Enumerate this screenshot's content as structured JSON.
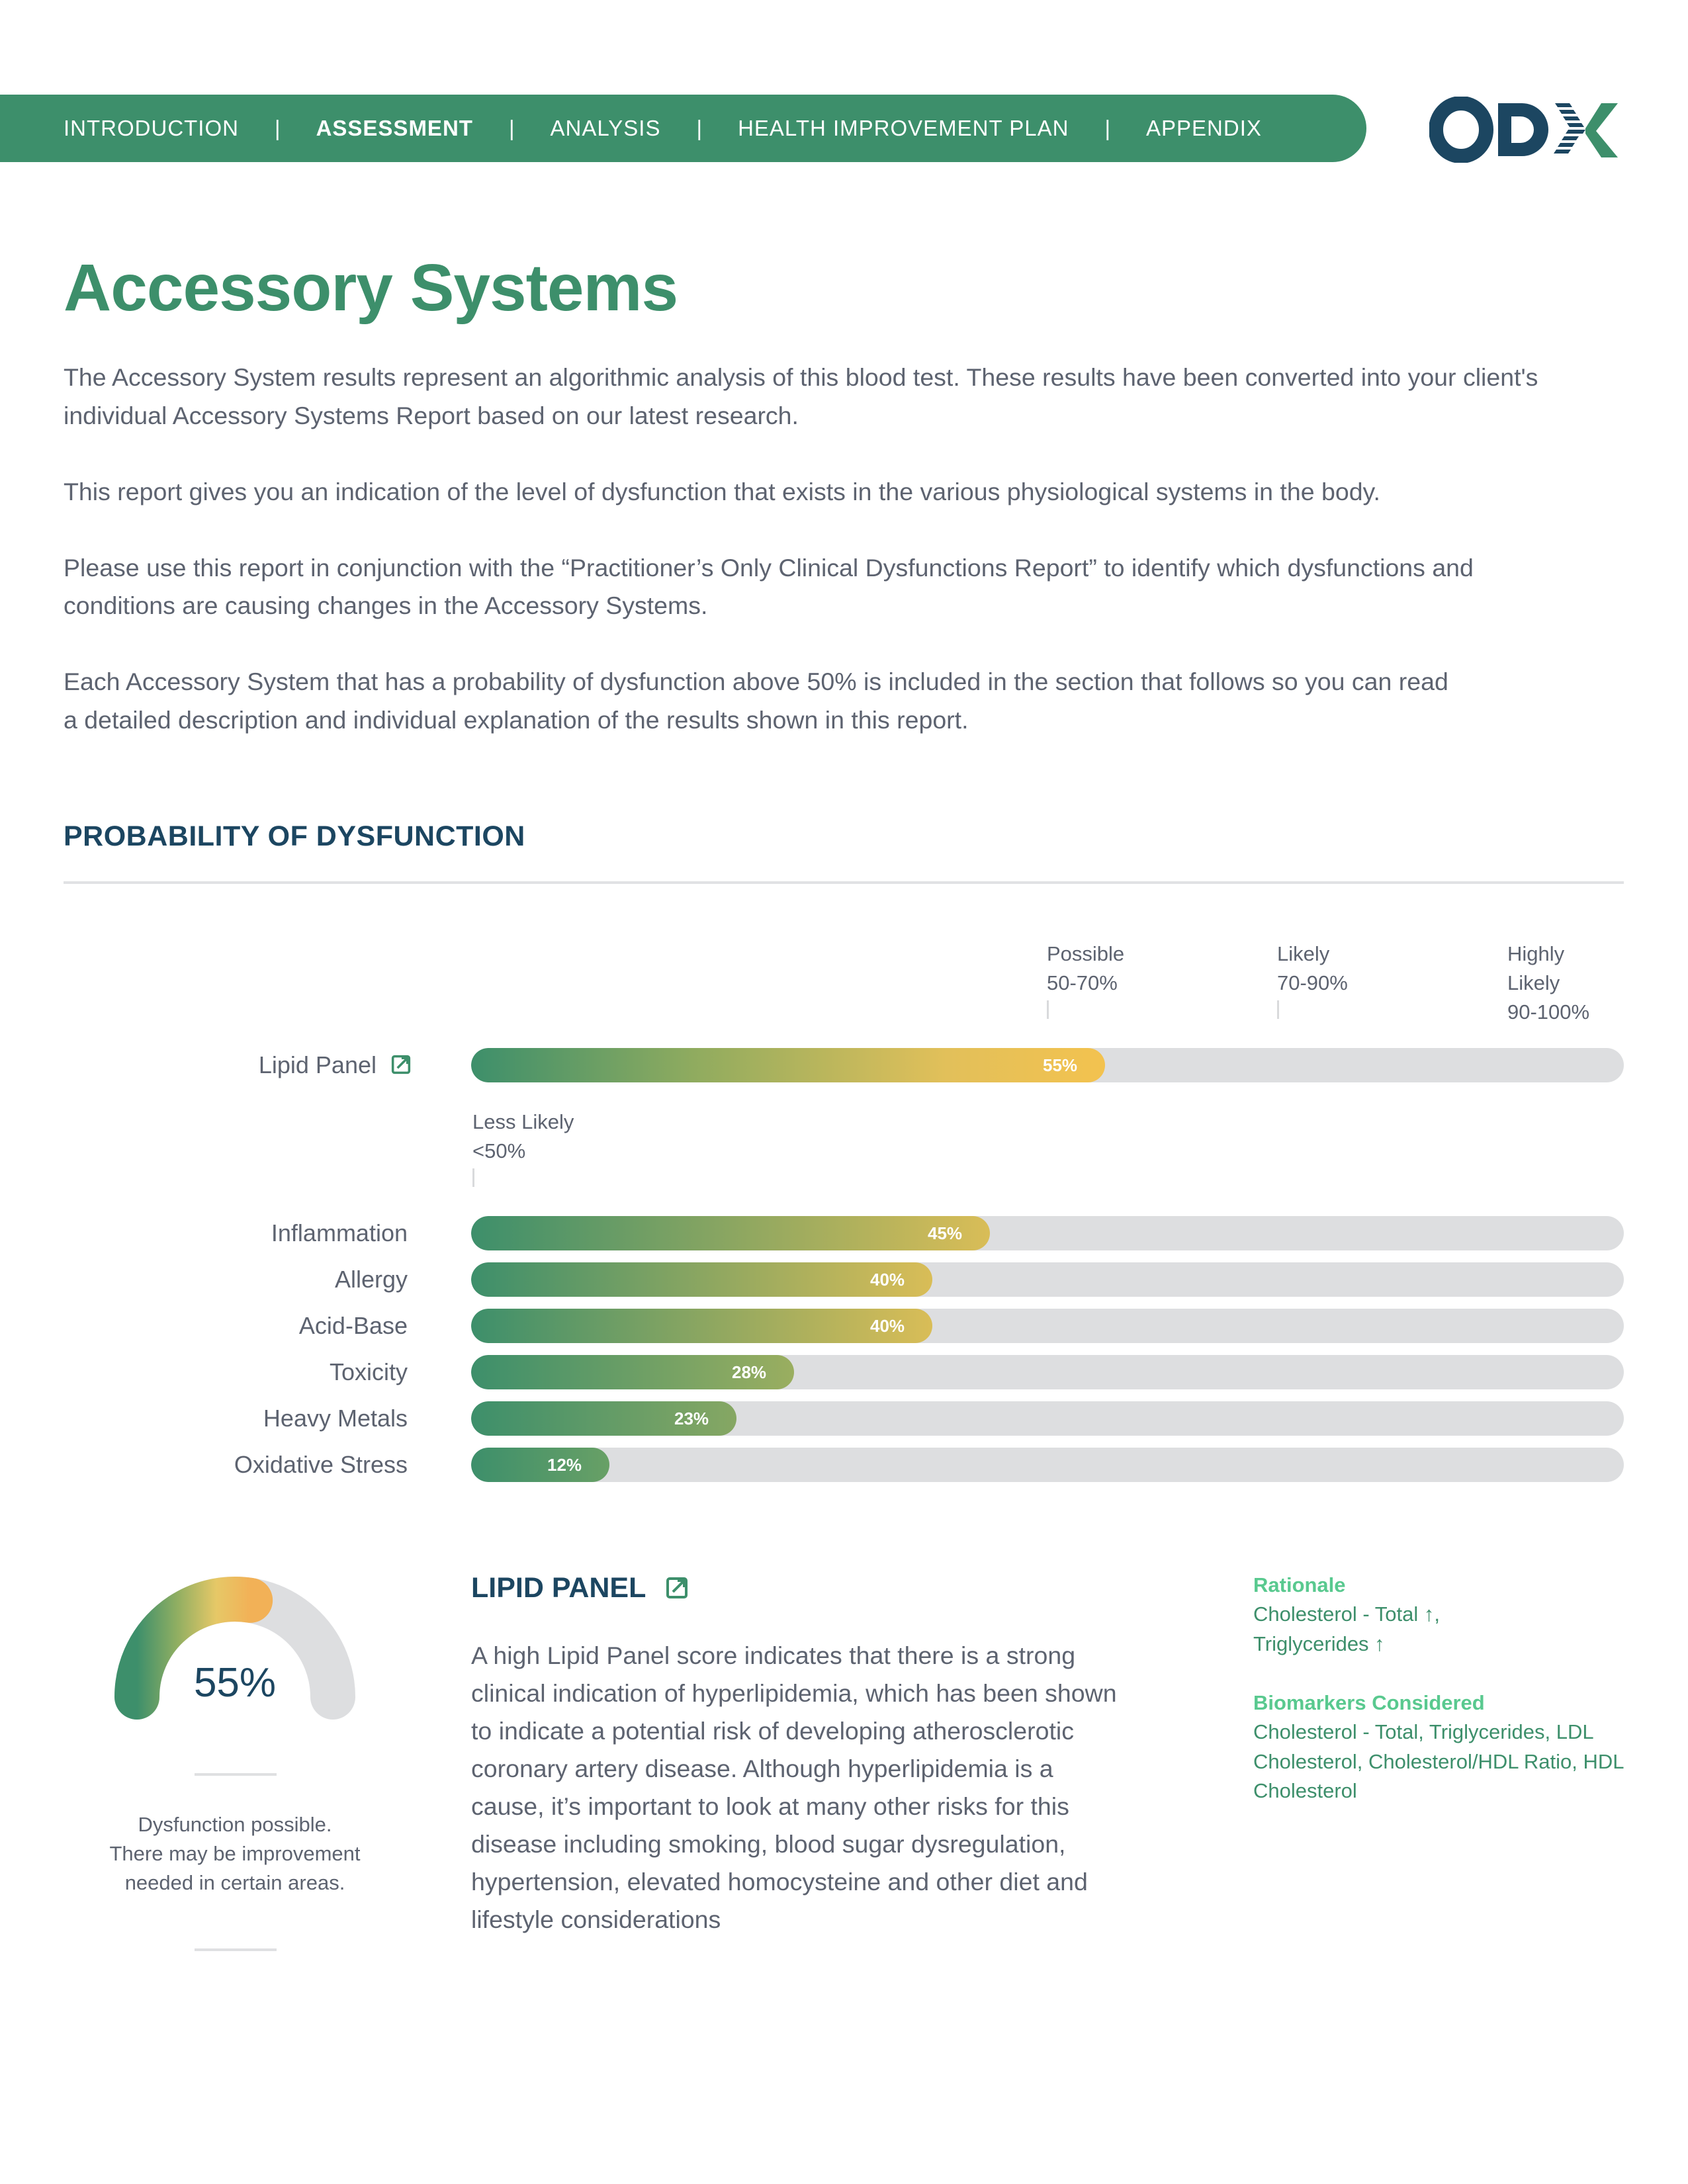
{
  "nav": {
    "items": [
      {
        "label": "INTRODUCTION",
        "active": false
      },
      {
        "label": "ASSESSMENT",
        "active": true
      },
      {
        "label": "ANALYSIS",
        "active": false
      },
      {
        "label": "HEALTH IMPROVEMENT PLAN",
        "active": false
      },
      {
        "label": "APPENDIX",
        "active": false
      }
    ],
    "separator": "|"
  },
  "logo": {
    "text": "ODX",
    "colors": {
      "navy": "#1c4661",
      "green": "#3d8f6b"
    }
  },
  "page": {
    "title": "Accessory Systems",
    "intro": [
      "The Accessory System results represent an algorithmic analysis of this blood test. These results have been converted into your client's individual Accessory Systems Report based on our latest research.",
      "This report gives you an indication of the level of dysfunction that exists in the various physiological systems in the body.",
      "Please use this report in conjunction with the “Practitioner’s Only Clinical Dysfunctions Report” to identify which dysfunctions and conditions are causing changes in the Accessory Systems.",
      "Each Accessory System that has a probability of dysfunction above 50% is included in the section that follows so you can read a detailed description and individual explanation of the results shown in this report."
    ]
  },
  "colors": {
    "brand_green": "#3d8f6b",
    "navy": "#1c4661",
    "yellow": "#f3c24f",
    "track_gray": "#dddee0",
    "light_green": "#59c98f"
  },
  "chart_data": {
    "type": "bar",
    "orientation": "horizontal",
    "title": "PROBABILITY OF DYSFUNCTION",
    "xlim": [
      0,
      100
    ],
    "unit": "%",
    "ranges": [
      {
        "name": "Less Likely",
        "label": "<50%",
        "from": 0,
        "to": 50
      },
      {
        "name": "Possible",
        "label": "50-70%",
        "from": 50,
        "to": 70
      },
      {
        "name": "Likely",
        "label": "70-90%",
        "from": 70,
        "to": 90
      },
      {
        "name": "Highly Likely",
        "label": "90-100%",
        "from": 90,
        "to": 100
      }
    ],
    "categories": [
      "Lipid Panel",
      "Inflammation",
      "Allergy",
      "Acid-Base",
      "Toxicity",
      "Heavy Metals",
      "Oxidative Stress"
    ],
    "values": [
      55,
      45,
      40,
      40,
      28,
      23,
      12
    ],
    "value_labels": [
      "55%",
      "45%",
      "40%",
      "40%",
      "28%",
      "23%",
      "12%"
    ],
    "linked": [
      true,
      false,
      false,
      false,
      false,
      false,
      false
    ]
  },
  "detail": {
    "gauge_value": 55,
    "gauge_label": "55%",
    "gauge_caption": [
      "Dysfunction possible.",
      "There may be improvement",
      "needed in certain areas."
    ],
    "title": "LIPID PANEL",
    "body": "A high Lipid Panel score indicates that there is a strong clinical indication of hyperlipidemia, which has been shown to indicate a potential risk of developing atherosclerotic coronary artery disease. Although hyperlipidemia is a cause, it’s important to look at many other risks for this disease including smoking, blood sugar dysregulation, hypertension, elevated homocysteine and other diet and lifestyle considerations",
    "rationale_heading": "Rationale",
    "rationale_lines": [
      "Cholesterol - Total ↑,",
      "Triglycerides ↑"
    ],
    "biomarkers_heading": "Biomarkers Considered",
    "biomarkers": "Cholesterol - Total, Triglycerides, LDL Cholesterol, Cholesterol/HDL Ratio, HDL Cholesterol"
  }
}
